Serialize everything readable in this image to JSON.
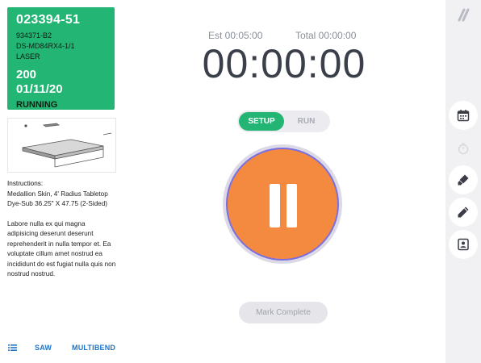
{
  "job": {
    "number": "023394-51",
    "part_number": "934371-B2",
    "part_description": "DS-MD84RX4-1/1",
    "process": "LASER",
    "quantity": "200",
    "due_date": "01/11/20",
    "status": "RUNNING",
    "status_color": "#22b573"
  },
  "instructions": {
    "label": "Instructions",
    "text": "Medallion Skin, 4' Radius Tabletop Dye-Sub 36.25\" X 47.75 (2-Sided)",
    "notes": "Labore nulla ex qui magna adipisicing deserunt deserunt reprehenderit in nulla tempor et. Ea voluptate cillum amet nostrud ea incididunt do est fugiat nulla quis non nostrud nostrud."
  },
  "bottom_nav": {
    "icon": "list-icon",
    "links": [
      "SAW",
      "MULTIBEND"
    ]
  },
  "timer": {
    "est_label": "Est 00:05:00",
    "total_label": "Total 00:00:00",
    "display": "00:00:00"
  },
  "mode_toggle": {
    "options": [
      "SETUP",
      "RUN"
    ],
    "selected": "SETUP"
  },
  "main_button": {
    "icon": "pause-icon",
    "color": "#f48a3f"
  },
  "actions": {
    "mark_complete": "Mark Complete"
  },
  "sidebar": {
    "logo": "logo-slash-icon",
    "buttons": [
      {
        "icon": "calendar-icon",
        "enabled": true
      },
      {
        "icon": "stopwatch-icon",
        "enabled": false
      },
      {
        "icon": "marker-icon",
        "enabled": true
      },
      {
        "icon": "pencil-icon",
        "enabled": true
      },
      {
        "icon": "contact-card-icon",
        "enabled": true
      }
    ]
  }
}
